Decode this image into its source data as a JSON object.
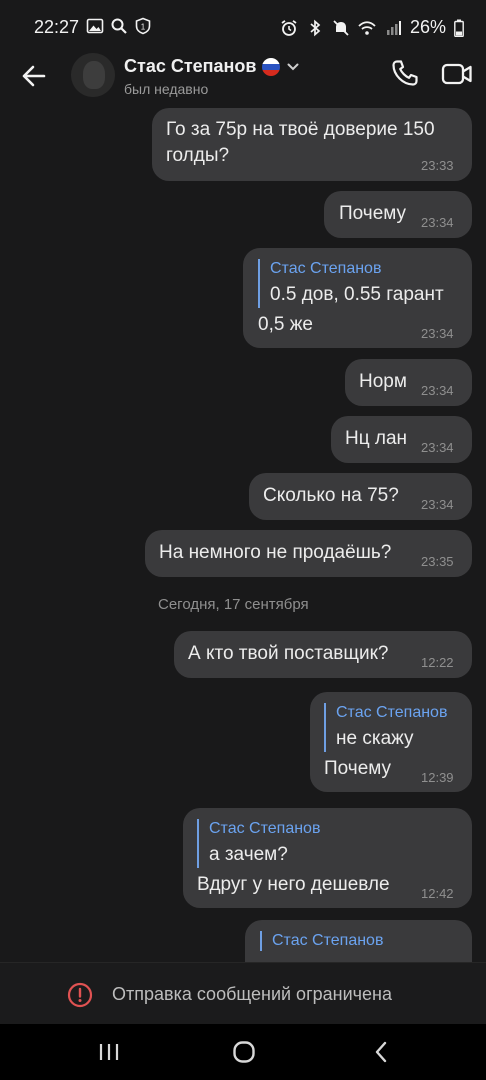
{
  "status": {
    "time": "22:27",
    "battery": "26%"
  },
  "header": {
    "name": "Стас Степанов",
    "status": "был недавно"
  },
  "messages": [
    {
      "line1": "Го за 75р на твоё доверие 150",
      "line2": "голды?",
      "time": "23:33"
    },
    {
      "text": "Почему",
      "time": "23:34"
    },
    {
      "quote_author": "Стас Степанов",
      "quote_text": "0.5 дов, 0.55 гарант",
      "text": "0,5 же",
      "time": "23:34"
    },
    {
      "text": "Норм",
      "time": "23:34"
    },
    {
      "text": "Нц лан",
      "time": "23:34"
    },
    {
      "text": "Сколько на 75?",
      "time": "23:34"
    },
    {
      "text": "На немного не продаёшь?",
      "time": "23:35"
    },
    {
      "text": "А кто твой поставщик?",
      "time": "12:22"
    },
    {
      "quote_author": "Стас Степанов",
      "quote_text": "не скажу",
      "text": "Почему",
      "time": "12:39"
    },
    {
      "quote_author": "Стас Степанов",
      "quote_text": "а зачем?",
      "text": "Вдруг у него дешевле",
      "time": "12:42"
    },
    {
      "quote_author": "Стас Степанов"
    }
  ],
  "date_separator": "Сегодня, 17 сентября",
  "restriction": {
    "text": "Отправка сообщений ограничена"
  },
  "colors": {
    "background": "#19191a",
    "bubble": "#3a3a3c",
    "quote_accent": "#6ba3f0",
    "warning": "#e05252"
  }
}
